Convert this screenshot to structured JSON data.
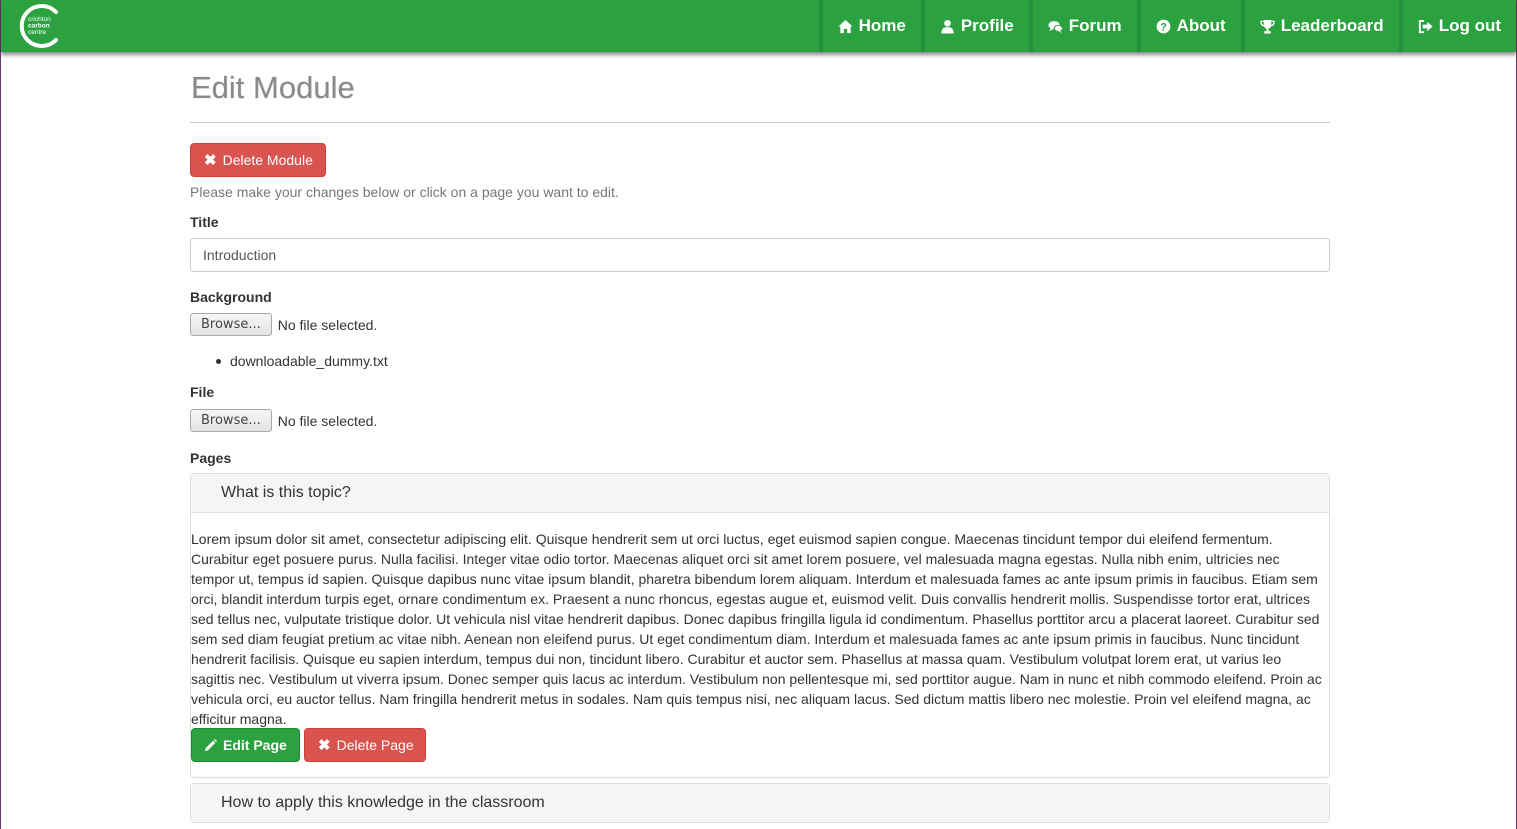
{
  "brand": {
    "logo_text": [
      "crichton",
      "carbon",
      "centre"
    ]
  },
  "nav": [
    {
      "label": "Home",
      "icon": "home-icon"
    },
    {
      "label": "Profile",
      "icon": "user-icon"
    },
    {
      "label": "Forum",
      "icon": "comments-icon"
    },
    {
      "label": "About",
      "icon": "question-circle-icon"
    },
    {
      "label": "Leaderboard",
      "icon": "trophy-icon"
    },
    {
      "label": "Log out",
      "icon": "sign-out-icon"
    }
  ],
  "page": {
    "title": "Edit Module",
    "delete_module_label": "Delete Module",
    "help_text": "Please make your changes below or click on a page you want to edit."
  },
  "form": {
    "title_label": "Title",
    "title_value": "Introduction",
    "background_label": "Background",
    "browse_label": "Browse...",
    "no_file_text": "No file selected.",
    "existing_file": "downloadable_dummy.txt",
    "file_label": "File",
    "pages_label": "Pages"
  },
  "pages": [
    {
      "title": "What is this topic?",
      "body": "Lorem ipsum dolor sit amet, consectetur adipiscing elit. Quisque hendrerit sem ut orci luctus, eget euismod sapien congue. Maecenas tincidunt tempor dui eleifend fermentum. Curabitur eget posuere purus. Nulla facilisi. Integer vitae odio tortor. Maecenas aliquet orci sit amet lorem posuere, vel malesuada magna egestas. Nulla nibh enim, ultricies nec tempor ut, tempus id sapien. Quisque dapibus nunc vitae ipsum blandit, pharetra bibendum lorem aliquam. Interdum et malesuada fames ac ante ipsum primis in faucibus. Etiam sem orci, blandit interdum turpis eget, ornare condimentum ex. Praesent a nunc rhoncus, egestas augue et, euismod velit. Duis convallis hendrerit mollis. Suspendisse tortor erat, ultrices sed tellus nec, vulputate tristique dolor. Ut vehicula nisl vitae hendrerit dapibus. Donec dapibus fringilla ligula id condimentum. Phasellus porttitor arcu a placerat laoreet. Curabitur sed sem sed diam feugiat pretium ac vitae nibh. Aenean non eleifend purus. Ut eget condimentum diam. Interdum et malesuada fames ac ante ipsum primis in faucibus. Nunc tincidunt hendrerit facilisis. Quisque eu sapien interdum, tempus dui non, tincidunt libero. Curabitur et auctor sem. Phasellus at massa quam. Vestibulum volutpat lorem erat, ut varius leo sagittis nec. Vestibulum ut viverra ipsum. Donec semper quis lacus ac interdum. Vestibulum non pellentesque mi, sed porttitor augue. Nam in nunc et nibh commodo eleifend. Proin ac vehicula orci, eu auctor tellus. Nam fringilla hendrerit metus in sodales. Nam quis tempus nisi, nec aliquam lacus. Sed dictum mattis libero nec molestie. Proin vel eleifend magna, ac efficitur magna.",
      "edit_label": "Edit Page",
      "delete_label": "Delete Page"
    },
    {
      "title": "How to apply this knowledge in the classroom"
    }
  ],
  "colors": {
    "brand_green": "#2ba23f",
    "danger": "#d9534f"
  }
}
